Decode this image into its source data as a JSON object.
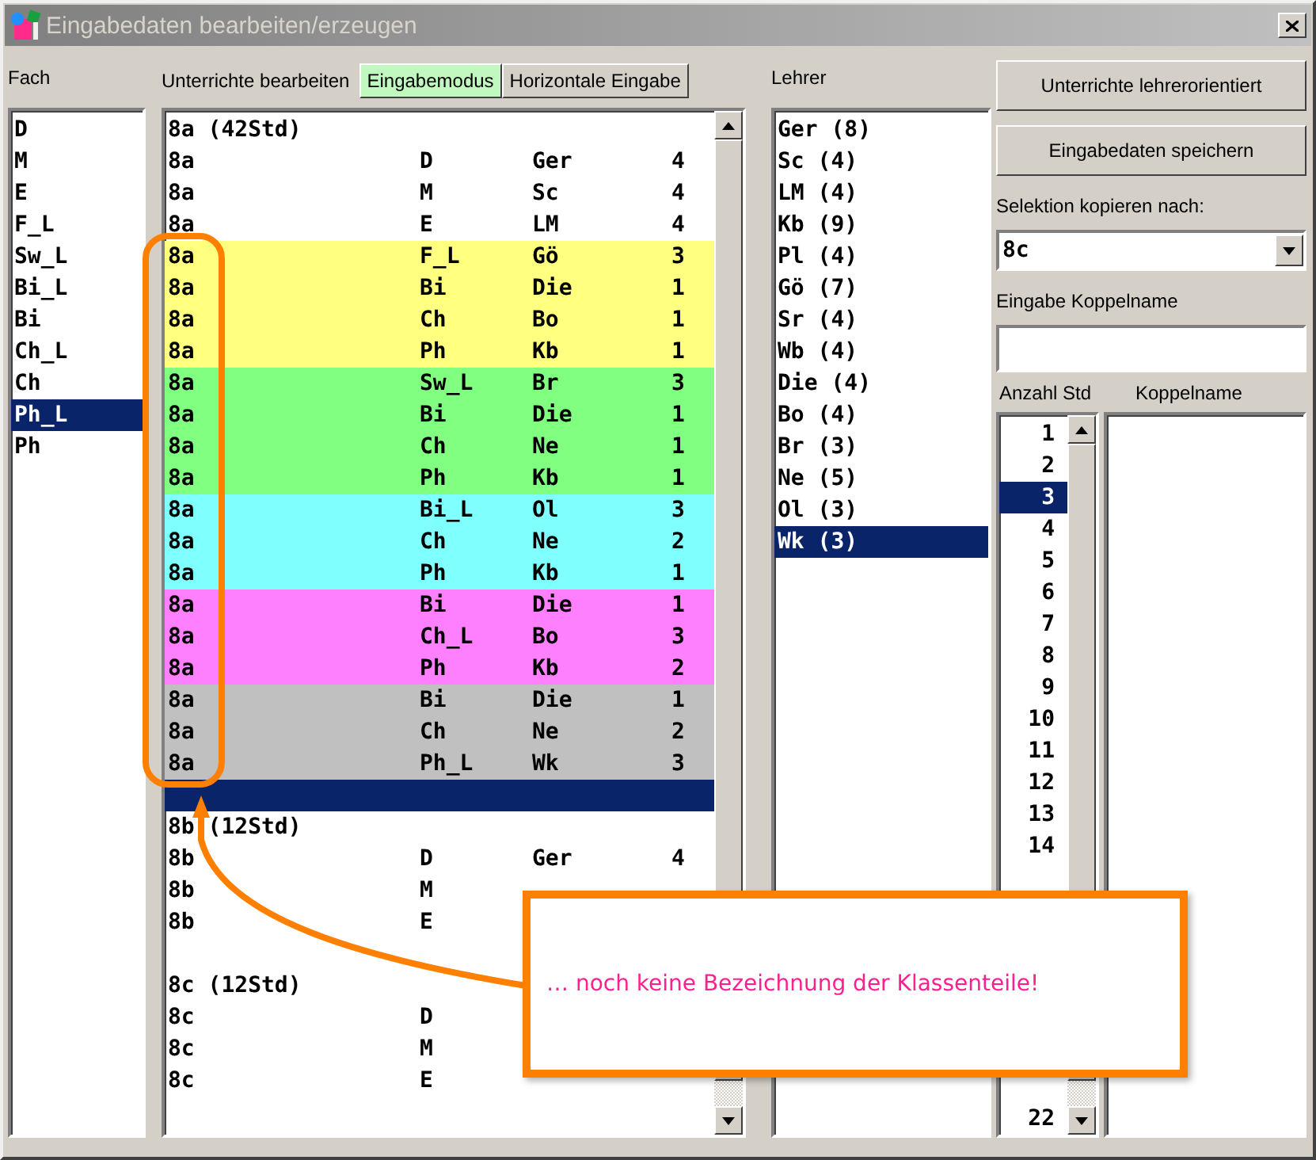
{
  "window": {
    "title": "Eingabedaten bearbeiten/erzeugen"
  },
  "subjects": {
    "label": "Fach",
    "items": [
      {
        "text": "D",
        "selected": false
      },
      {
        "text": "M",
        "selected": false
      },
      {
        "text": "E",
        "selected": false
      },
      {
        "text": "F_L",
        "selected": false
      },
      {
        "text": "Sw_L",
        "selected": false
      },
      {
        "text": "Bi_L",
        "selected": false
      },
      {
        "text": "Bi",
        "selected": false
      },
      {
        "text": "Ch_L",
        "selected": false
      },
      {
        "text": "Ch",
        "selected": false
      },
      {
        "text": "Ph_L",
        "selected": true
      },
      {
        "text": "Ph",
        "selected": false
      }
    ]
  },
  "lessons": {
    "label": "Unterrichte bearbeiten",
    "mode_buttons": [
      {
        "label": "Eingabemodus",
        "selected": true
      },
      {
        "label": "Horizontale Eingabe",
        "selected": false
      }
    ],
    "rows": [
      {
        "kind": "header",
        "text": "8a (42Std)",
        "selected": false
      },
      {
        "kind": "lesson",
        "class": "8a",
        "subject": "D",
        "teacher": "Ger",
        "hours": "4",
        "selected": false
      },
      {
        "kind": "lesson",
        "class": "8a",
        "subject": "M",
        "teacher": "Sc",
        "hours": "4",
        "selected": false
      },
      {
        "kind": "lesson",
        "class": "8a",
        "subject": "E",
        "teacher": "LM",
        "hours": "4",
        "selected": false
      },
      {
        "kind": "lesson",
        "class": "8a",
        "subject": "F_L",
        "teacher": "Gö",
        "hours": "3",
        "color": "#ffff80",
        "selected": false
      },
      {
        "kind": "lesson",
        "class": "8a",
        "subject": "Bi",
        "teacher": "Die",
        "hours": "1",
        "color": "#ffff80",
        "selected": false
      },
      {
        "kind": "lesson",
        "class": "8a",
        "subject": "Ch",
        "teacher": "Bo",
        "hours": "1",
        "color": "#ffff80",
        "selected": false
      },
      {
        "kind": "lesson",
        "class": "8a",
        "subject": "Ph",
        "teacher": "Kb",
        "hours": "1",
        "color": "#ffff80",
        "selected": false
      },
      {
        "kind": "lesson",
        "class": "8a",
        "subject": "Sw_L",
        "teacher": "Br",
        "hours": "3",
        "color": "#80ff80",
        "selected": false
      },
      {
        "kind": "lesson",
        "class": "8a",
        "subject": "Bi",
        "teacher": "Die",
        "hours": "1",
        "color": "#80ff80",
        "selected": false
      },
      {
        "kind": "lesson",
        "class": "8a",
        "subject": "Ch",
        "teacher": "Ne",
        "hours": "1",
        "color": "#80ff80",
        "selected": false
      },
      {
        "kind": "lesson",
        "class": "8a",
        "subject": "Ph",
        "teacher": "Kb",
        "hours": "1",
        "color": "#80ff80",
        "selected": false
      },
      {
        "kind": "lesson",
        "class": "8a",
        "subject": "Bi_L",
        "teacher": "Ol",
        "hours": "3",
        "color": "#80ffff",
        "selected": false
      },
      {
        "kind": "lesson",
        "class": "8a",
        "subject": "Ch",
        "teacher": "Ne",
        "hours": "2",
        "color": "#80ffff",
        "selected": false
      },
      {
        "kind": "lesson",
        "class": "8a",
        "subject": "Ph",
        "teacher": "Kb",
        "hours": "1",
        "color": "#80ffff",
        "selected": false
      },
      {
        "kind": "lesson",
        "class": "8a",
        "subject": "Bi",
        "teacher": "Die",
        "hours": "1",
        "color": "#ff80ff",
        "selected": false
      },
      {
        "kind": "lesson",
        "class": "8a",
        "subject": "Ch_L",
        "teacher": "Bo",
        "hours": "3",
        "color": "#ff80ff",
        "selected": false
      },
      {
        "kind": "lesson",
        "class": "8a",
        "subject": "Ph",
        "teacher": "Kb",
        "hours": "2",
        "color": "#ff80ff",
        "selected": false
      },
      {
        "kind": "lesson",
        "class": "8a",
        "subject": "Bi",
        "teacher": "Die",
        "hours": "1",
        "color": "#c0c0c0",
        "selected": false
      },
      {
        "kind": "lesson",
        "class": "8a",
        "subject": "Ch",
        "teacher": "Ne",
        "hours": "2",
        "color": "#c0c0c0",
        "selected": false
      },
      {
        "kind": "lesson",
        "class": "8a",
        "subject": "Ph_L",
        "teacher": "Wk",
        "hours": "3",
        "color": "#c0c0c0",
        "selected": false
      },
      {
        "kind": "blank",
        "selected": true
      },
      {
        "kind": "header",
        "text": "8b (12Std)",
        "selected": false
      },
      {
        "kind": "lesson",
        "class": "8b",
        "subject": "D",
        "teacher": "Ger",
        "hours": "4",
        "selected": false
      },
      {
        "kind": "lesson",
        "class": "8b",
        "subject": "M",
        "selected": false
      },
      {
        "kind": "lesson",
        "class": "8b",
        "subject": "E",
        "selected": false
      },
      {
        "kind": "blank",
        "selected": false
      },
      {
        "kind": "header",
        "text": "8c (12Std)",
        "selected": false
      },
      {
        "kind": "lesson",
        "class": "8c",
        "subject": "D",
        "selected": false
      },
      {
        "kind": "lesson",
        "class": "8c",
        "subject": "M",
        "selected": false
      },
      {
        "kind": "lesson",
        "class": "8c",
        "subject": "E",
        "selected": false
      }
    ]
  },
  "teachers": {
    "label": "Lehrer",
    "items": [
      {
        "text": "Ger (8)",
        "selected": false
      },
      {
        "text": "Sc (4)",
        "selected": false
      },
      {
        "text": "LM (4)",
        "selected": false
      },
      {
        "text": "Kb (9)",
        "selected": false
      },
      {
        "text": "Pl (4)",
        "selected": false
      },
      {
        "text": "Gö (7)",
        "selected": false
      },
      {
        "text": "Sr (4)",
        "selected": false
      },
      {
        "text": "Wb (4)",
        "selected": false
      },
      {
        "text": "Die (4)",
        "selected": false
      },
      {
        "text": "Bo (4)",
        "selected": false
      },
      {
        "text": "Br (3)",
        "selected": false
      },
      {
        "text": "Ne (5)",
        "selected": false
      },
      {
        "text": "Ol (3)",
        "selected": false
      },
      {
        "text": "Wk (3)",
        "selected": true
      }
    ]
  },
  "actions": [
    "Unterrichte lehrerorientiert",
    "Eingabedaten speichern"
  ],
  "copy_selection": {
    "label": "Selektion kopieren nach:",
    "value": "8c"
  },
  "coupling_name": {
    "label": "Eingabe Koppelname"
  },
  "hours": {
    "label": "Anzahl Std",
    "items": [
      {
        "text": "1",
        "selected": false
      },
      {
        "text": "2",
        "selected": false
      },
      {
        "text": "3",
        "selected": true
      },
      {
        "text": "4",
        "selected": false
      },
      {
        "text": "5",
        "selected": false
      },
      {
        "text": "6",
        "selected": false
      },
      {
        "text": "7",
        "selected": false
      },
      {
        "text": "8",
        "selected": false
      },
      {
        "text": "9",
        "selected": false
      },
      {
        "text": "10",
        "selected": false
      },
      {
        "text": "11",
        "selected": false
      },
      {
        "text": "12",
        "selected": false
      },
      {
        "text": "13",
        "selected": false
      },
      {
        "text": "14",
        "selected": false
      },
      {
        "text": "22",
        "selected": false
      }
    ]
  },
  "coupling_list": {
    "label": "Koppelname"
  },
  "annotation": {
    "text": "… noch keine Bezeichnung der Klassenteile!"
  }
}
